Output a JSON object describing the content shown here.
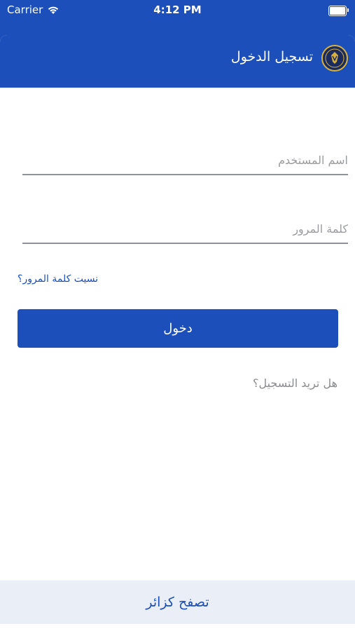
{
  "status_bar": {
    "carrier": "Carrier",
    "time": "4:12 PM"
  },
  "nav": {
    "title": "تسجيل الدخول",
    "emblem_icon": "police-emblem-icon"
  },
  "form": {
    "username_placeholder": "اسم المستخدم",
    "password_placeholder": "كلمة المرور",
    "forgot_password": "نسيت كلمة المرور؟",
    "login_button": "دخول",
    "register_prompt": "هل تريد التسجيل؟"
  },
  "footer": {
    "guest_label": "تصفح كزائر"
  },
  "colors": {
    "primary": "#1c4fba",
    "footer_bg": "#e9eef7",
    "muted_text": "#8a8c90"
  }
}
